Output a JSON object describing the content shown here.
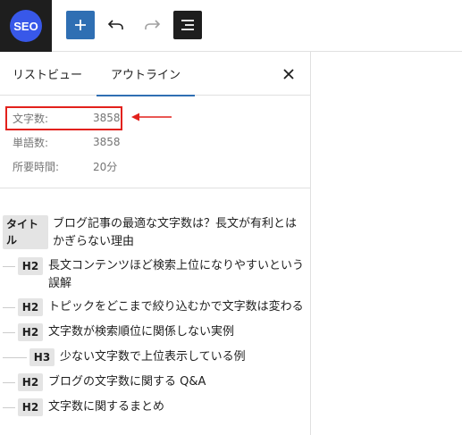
{
  "toolbar": {
    "logo_text": "SEO",
    "add_icon": "plus-icon",
    "undo_icon": "undo-icon",
    "redo_icon": "redo-icon",
    "outline_icon": "document-outline-icon",
    "accent_color": "#2f6fb3"
  },
  "panel": {
    "tabs": [
      {
        "label": "リストビュー",
        "active": false
      },
      {
        "label": "アウトライン",
        "active": true
      }
    ],
    "close_icon": "close-icon"
  },
  "stats": {
    "items": [
      {
        "label": "文字数:",
        "value": "3858"
      },
      {
        "label": "単語数:",
        "value": "3858"
      },
      {
        "label": "所要時間:",
        "value": "20分"
      }
    ],
    "highlight_color": "#e2211c"
  },
  "outline": {
    "title_tag": "タイトル",
    "title_text": "ブログ記事の最適な文字数は？長文が有利とはかぎらない理由",
    "headings": [
      {
        "level": "H2",
        "text": "長文コンテンツほど検索上位になりやすいという誤解"
      },
      {
        "level": "H2",
        "text": "トピックをどこまで絞り込むかで文字数は変わる"
      },
      {
        "level": "H2",
        "text": "文字数が検索順位に関係しない実例"
      },
      {
        "level": "H3",
        "text": "少ない文字数で上位表示している例"
      },
      {
        "level": "H2",
        "text": "ブログの文字数に関する Q&A"
      },
      {
        "level": "H2",
        "text": "文字数に関するまとめ"
      }
    ]
  }
}
